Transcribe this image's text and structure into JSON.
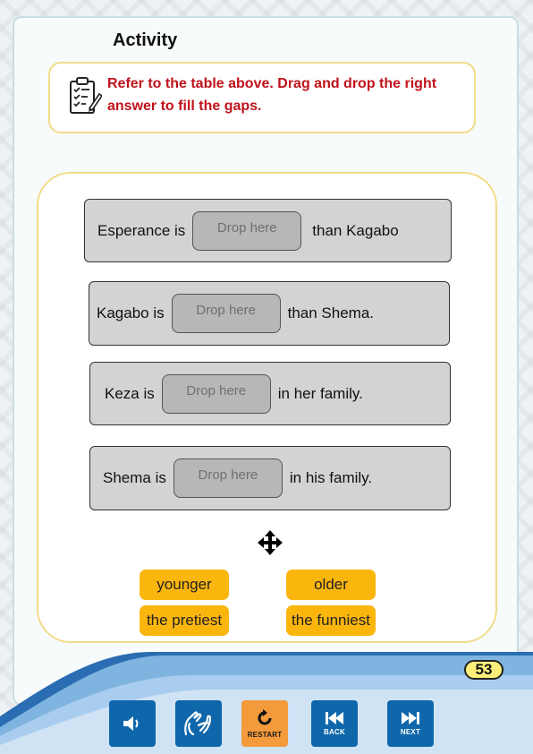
{
  "activity": {
    "title": "Activity",
    "instruction": "Refer to the table above. Drag and drop the right answer to fill the gaps."
  },
  "sentences": [
    {
      "before": "Esperance is",
      "slot": "Drop here",
      "after": "than Kagabo"
    },
    {
      "before": "Kagabo is",
      "slot": "Drop here",
      "after": "than Shema."
    },
    {
      "before": "Keza is",
      "slot": "Drop here",
      "after": "in her family."
    },
    {
      "before": "Shema is",
      "slot": "Drop here",
      "after": "in his family."
    }
  ],
  "answers": [
    "younger",
    "older",
    "the pretiest",
    "the funniest"
  ],
  "page_number": "53",
  "nav": {
    "audio": "speaker-icon",
    "sign_language": "sign-language-icon",
    "restart_label": "RESTART",
    "back_label": "BACK",
    "next_label": "NEXT"
  },
  "colors": {
    "instruction_text": "#c0121b",
    "chip": "#fbb60e",
    "nav_button": "#0f67ab",
    "restart_button": "#f39a3c",
    "border_yellow": "#f2dc8a"
  }
}
